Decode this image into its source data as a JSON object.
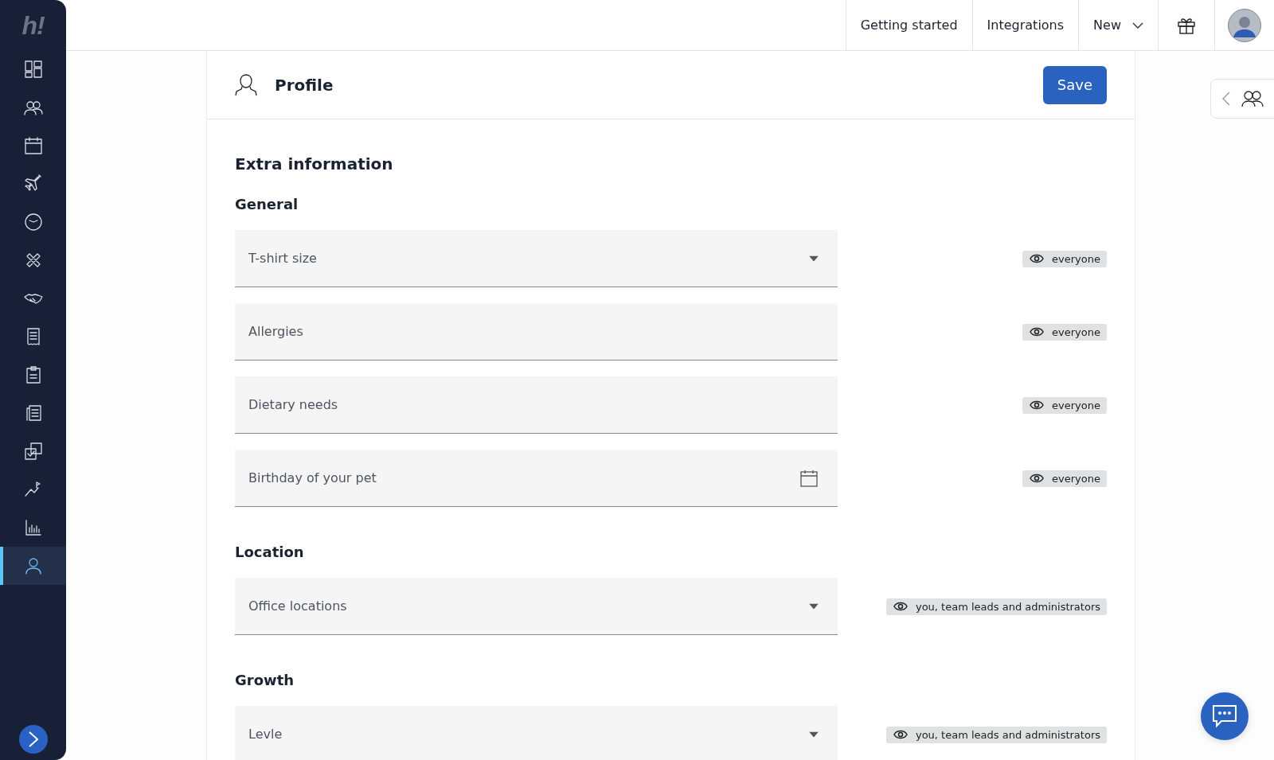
{
  "sidebar": {
    "logo": "h!",
    "items": [
      {
        "selected": false
      },
      {
        "selected": false
      },
      {
        "selected": false
      },
      {
        "selected": false
      },
      {
        "selected": false
      },
      {
        "selected": false
      },
      {
        "selected": false
      },
      {
        "selected": false
      },
      {
        "selected": false
      },
      {
        "selected": false
      },
      {
        "selected": false
      },
      {
        "selected": false
      },
      {
        "selected": false
      },
      {
        "selected": true
      }
    ]
  },
  "people_panel": {
    "expanded": false
  },
  "topbar": {
    "links": [
      "Getting started",
      "Integrations"
    ],
    "new_menu": "New"
  },
  "page": {
    "title": "Profile",
    "save_button": "Save",
    "heading": "Extra information",
    "sections": [
      {
        "heading": "General",
        "fields": [
          {
            "kind": "select",
            "placeholder": "T-shirt size",
            "visibility": "everyone"
          },
          {
            "kind": "text",
            "placeholder": "Allergies",
            "visibility": "everyone"
          },
          {
            "kind": "text",
            "placeholder": "Dietary needs",
            "visibility": "everyone"
          },
          {
            "kind": "date",
            "placeholder": "Birthday of your pet",
            "visibility": "everyone"
          }
        ]
      },
      {
        "heading": "Location",
        "fields": [
          {
            "kind": "select",
            "placeholder": "Office locations",
            "visibility": "you, team leads and administrators"
          }
        ]
      },
      {
        "heading": "Growth",
        "fields": [
          {
            "kind": "select",
            "placeholder": "Levle",
            "visibility": "you, team leads and administrators"
          }
        ]
      }
    ]
  }
}
